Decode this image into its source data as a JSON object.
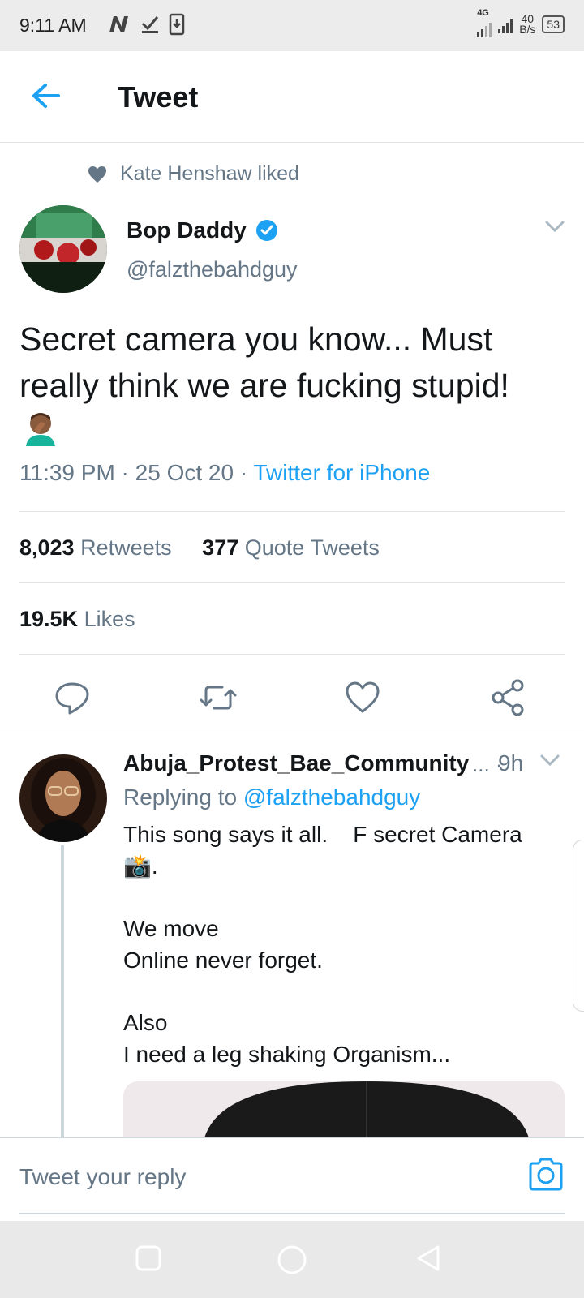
{
  "status_bar": {
    "time": "9:11 AM",
    "network": "4G",
    "speed_value": "40",
    "speed_unit": "B/s",
    "battery": "53"
  },
  "header": {
    "title": "Tweet",
    "back_icon": "back-arrow-icon"
  },
  "social_context": {
    "text": "Kate Henshaw liked",
    "icon": "heart-icon"
  },
  "tweet": {
    "author_name": "Bop Daddy",
    "verified": true,
    "handle": "@falzthebahdguy",
    "text": "Secret camera you know... Must really think we are fucking stupid!",
    "emoji": "🤦🏾‍♂️",
    "time": "11:39 PM",
    "date": "25 Oct 20",
    "source": "Twitter for iPhone"
  },
  "stats": {
    "retweets_count": "8,023",
    "retweets_label": "Retweets",
    "quotes_count": "377",
    "quotes_label": "Quote Tweets",
    "likes_count": "19.5K",
    "likes_label": "Likes"
  },
  "actions": [
    "reply-icon",
    "retweet-icon",
    "like-icon",
    "share-icon"
  ],
  "reply": {
    "author_name": "Abuja_Protest_Bae_Community",
    "dots": "...",
    "sep": "·",
    "time": "9h",
    "replying_prefix": "Replying to",
    "replying_handle": "@falzthebahdguy",
    "line1": "This song says it all.    F secret Camera",
    "line2": "📸.",
    "line3": "We move",
    "line4": "Online never forget.",
    "line5": "Also",
    "line6": "I need a leg shaking Organism..."
  },
  "composer": {
    "placeholder": "Tweet your reply",
    "camera_icon": "camera-icon"
  },
  "nav": [
    "recents-icon",
    "home-icon",
    "back-icon"
  ],
  "colors": {
    "accent": "#1da1f2",
    "secondary_text": "#657786",
    "primary_text": "#14171a"
  }
}
